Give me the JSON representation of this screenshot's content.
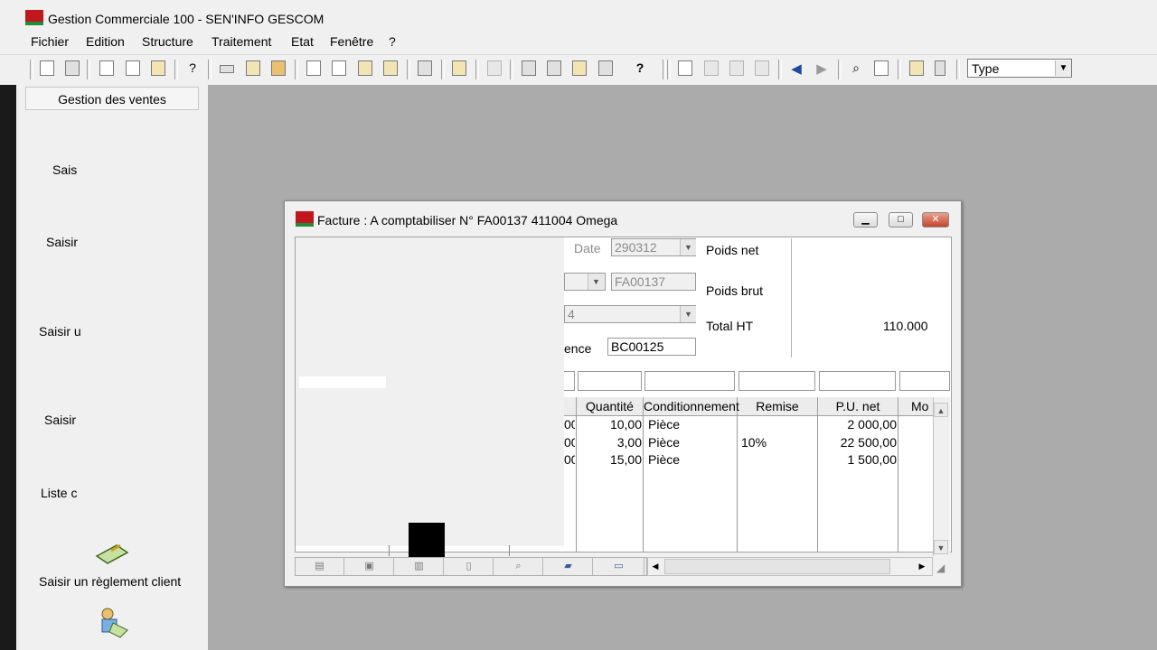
{
  "app": {
    "title": "Gestion Commerciale 100 - SEN'INFO GESCOM"
  },
  "menu": {
    "items": [
      "Fichier",
      "Edition",
      "Structure",
      "Traitement",
      "Etat",
      "Fenêtre",
      "?"
    ]
  },
  "toolbar": {
    "type_combo_value": "Type"
  },
  "sidebar": {
    "header": "Gestion des ventes",
    "items": [
      "Sais",
      "Saisir",
      "Saisir u",
      "Saisir",
      "Liste c",
      "Saisir un règlement client"
    ]
  },
  "invoice": {
    "title": "Facture : A comptabiliser N° FA00137 411004 Omega",
    "date_label": "Date",
    "date_value": "290312",
    "piece_value": "FA00137",
    "combo_partial": "4",
    "reference_label": "ence",
    "reference_value": "BC00125",
    "poids_net_label": "Poids net",
    "poids_brut_label": "Poids brut",
    "total_ht_label": "Total HT",
    "total_ht_value": "110.000",
    "columns": [
      "Quantité",
      "Conditionnement",
      "Remise",
      "P.U. net",
      "Mo"
    ],
    "rows": [
      {
        "prefix": "00",
        "quantite": "10,00",
        "conditionnement": "Pièce",
        "remise": "",
        "pu_net": "2 000,00"
      },
      {
        "prefix": "00",
        "quantite": "3,00",
        "conditionnement": "Pièce",
        "remise": "10%",
        "pu_net": "22 500,00"
      },
      {
        "prefix": "00",
        "quantite": "15,00",
        "conditionnement": "Pièce",
        "remise": "",
        "pu_net": "1 500,00"
      }
    ]
  },
  "colors": {
    "brand_red": "#c0161e",
    "brand_green": "#1e8c3a",
    "mdi_background": "#ababab"
  }
}
